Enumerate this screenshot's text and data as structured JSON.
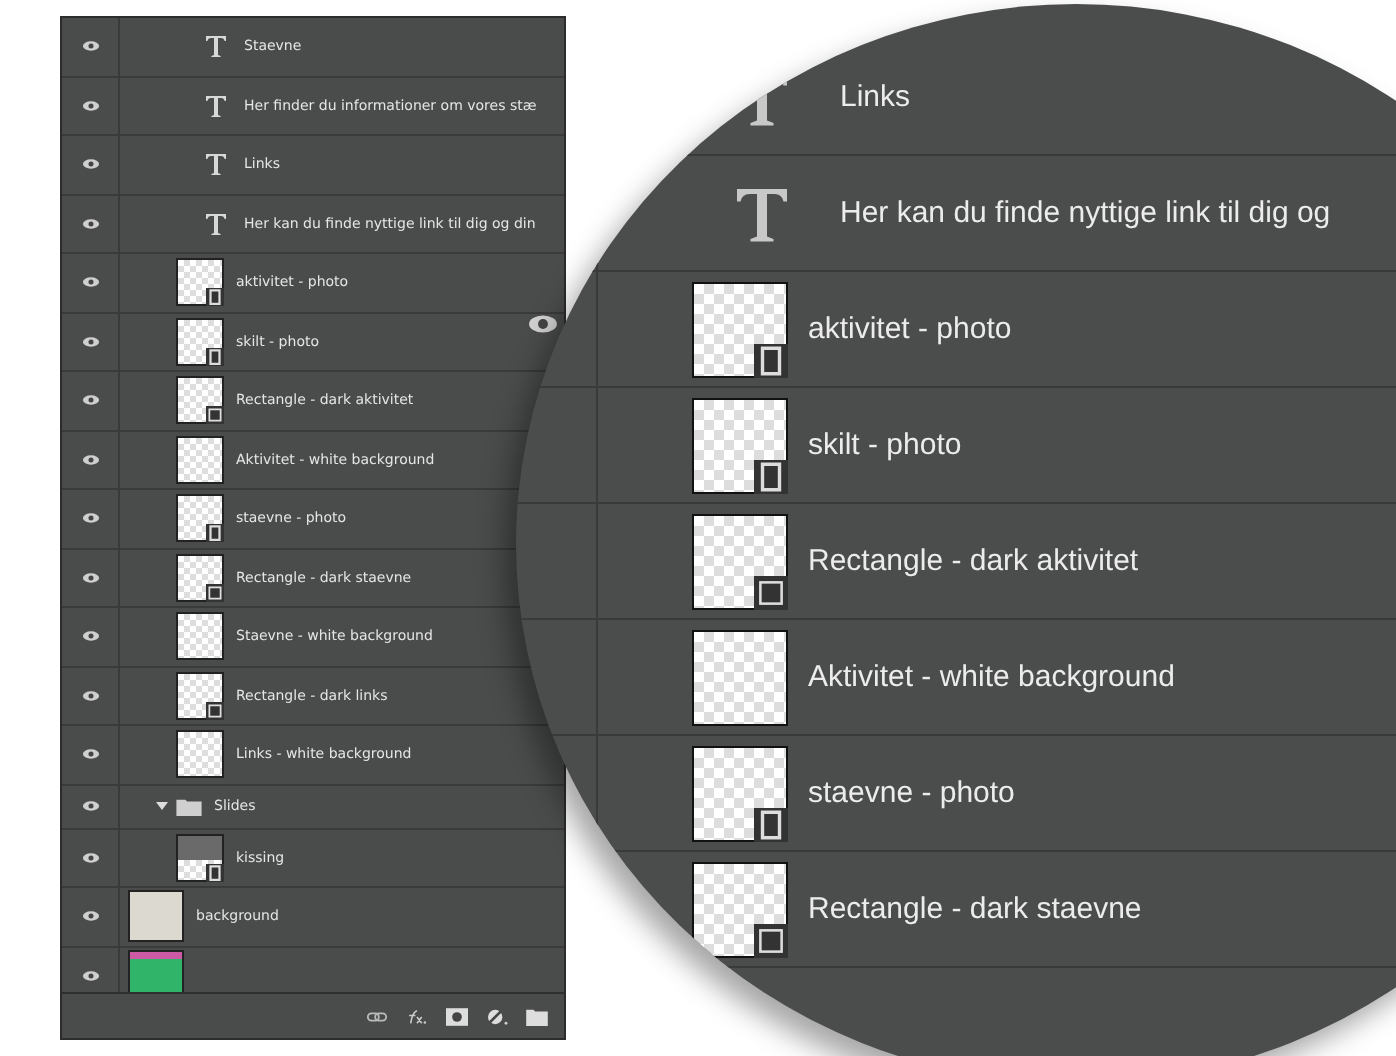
{
  "layers": [
    {
      "name": "Staevne",
      "kind": "text",
      "visible": true
    },
    {
      "name": "Her finder du informationer om vores stæ",
      "kind": "text",
      "visible": true
    },
    {
      "name": "Links",
      "kind": "text",
      "visible": true
    },
    {
      "name": "Her kan du finde nyttige link til dig og din",
      "kind": "text",
      "visible": true
    },
    {
      "name": "aktivitet - photo",
      "kind": "smart",
      "visible": true
    },
    {
      "name": "skilt - photo",
      "kind": "smart",
      "visible": true
    },
    {
      "name": "Rectangle - dark aktivitet",
      "kind": "shape",
      "visible": true
    },
    {
      "name": "Aktivitet - white background",
      "kind": "pixel",
      "visible": true
    },
    {
      "name": "staevne - photo",
      "kind": "smart",
      "visible": true
    },
    {
      "name": "Rectangle - dark staevne",
      "kind": "shape",
      "visible": true
    },
    {
      "name": "Staevne - white background",
      "kind": "pixel",
      "visible": true
    },
    {
      "name": "Rectangle - dark links",
      "kind": "shape",
      "visible": true
    },
    {
      "name": "Links - white background",
      "kind": "pixel",
      "visible": true
    },
    {
      "name": "Slides",
      "kind": "group",
      "visible": true,
      "expanded": true,
      "children": [
        {
          "name": "kissing",
          "kind": "photo",
          "visible": true
        }
      ]
    },
    {
      "name": "background",
      "kind": "fill",
      "visible": true
    },
    {
      "kind": "colorful",
      "visible": true
    }
  ],
  "magnifier": {
    "layers": [
      {
        "name": "Links",
        "kind": "text"
      },
      {
        "name": "Her kan du finde nyttige link til dig og",
        "kind": "text"
      },
      {
        "name": "aktivitet - photo",
        "kind": "smart"
      },
      {
        "name": "skilt - photo",
        "kind": "smart"
      },
      {
        "name": "Rectangle - dark aktivitet",
        "kind": "shape"
      },
      {
        "name": "Aktivitet - white background",
        "kind": "pixel"
      },
      {
        "name": "staevne - photo",
        "kind": "smart"
      },
      {
        "name": "Rectangle - dark staevne",
        "kind": "shape"
      }
    ]
  }
}
